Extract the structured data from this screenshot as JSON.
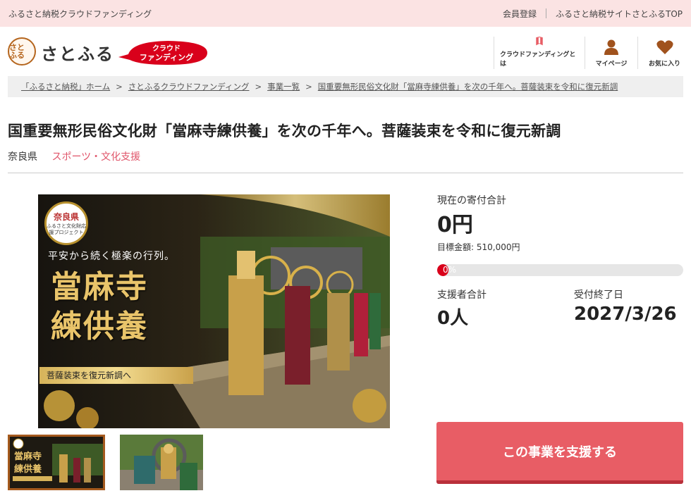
{
  "topbar": {
    "site_label": "ふるさと納税クラウドファンディング",
    "register": "会員登録",
    "top_link": "ふるさと納税サイトさとふるTOP"
  },
  "header": {
    "logo_text": "さとふる",
    "logo_mark": "さと ふる",
    "cf_badge_line1": "クラウド",
    "cf_badge_line2": "ファンディング",
    "nav": [
      {
        "label": "クラウドファンディングとは",
        "icon": "bookmark-icon"
      },
      {
        "label": "マイページ",
        "icon": "user-icon"
      },
      {
        "label": "お気に入り",
        "icon": "heart-icon"
      }
    ]
  },
  "breadcrumb": [
    "「ふるさと納税」ホーム",
    "さとふるクラウドファンディング",
    "事業一覧",
    "国重要無形民俗文化財「當麻寺練供養」を次の千年へ。菩薩装束を令和に復元新調"
  ],
  "project": {
    "title": "国重要無形民俗文化財「當麻寺練供養」を次の千年へ。菩薩装束を令和に復元新調",
    "prefecture": "奈良県",
    "category": "スポーツ・文化支援"
  },
  "hero": {
    "badge_main": "奈良県",
    "badge_sub": "ふるさと文化財応援プロジェクト",
    "subtitle": "平安から続く極楽の行列。",
    "big_line1": "當麻寺",
    "big_line2": "練供養",
    "banner": "菩薩装束を復元新調へ"
  },
  "stats": {
    "total_label": "現在の寄付合計",
    "total_value": "0円",
    "target_text": "目標金額: 510,000円",
    "progress_text": "0%",
    "progress_value": 0,
    "supporters_label": "支援者合計",
    "supporters_value": "0人",
    "deadline_label": "受付終了日",
    "deadline_value": "2027/3/26"
  },
  "cta": {
    "label": "この事業を支援する"
  },
  "colors": {
    "accent": "#e85d65",
    "topbar_bg": "#fbe3e3",
    "category": "#e0556a",
    "progress_fill": "#d9001b"
  }
}
